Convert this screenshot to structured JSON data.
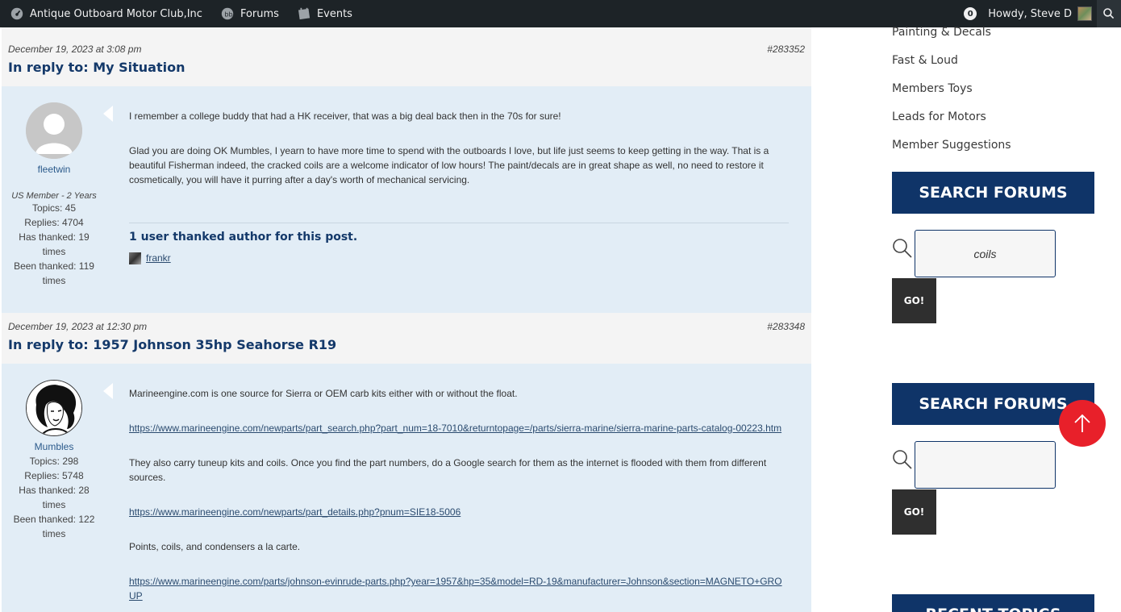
{
  "adminbar": {
    "site_name": "Antique Outboard Motor Club,Inc",
    "forums_label": "Forums",
    "events_label": "Events",
    "notification_count": "0",
    "howdy": "Howdy, Steve D"
  },
  "posts": [
    {
      "date": "December 19, 2023 at 3:08 pm",
      "id": "#283352",
      "title": "In reply to: My Situation",
      "author": {
        "name": "fleetwin",
        "role": "US Member - 2 Years",
        "topics": "Topics: 45",
        "replies": "Replies: 4704",
        "has_thanked_a": "Has thanked: 19",
        "has_thanked_b": "times",
        "been_thanked_a": "Been thanked: 119",
        "been_thanked_b": "times"
      },
      "paragraphs": [
        "I remember a college buddy that had a HK receiver, that was a big deal back then in the 70s for sure!",
        "Glad you are doing OK Mumbles, I yearn to have more time to spend with the outboards I love, but life just seems to keep getting in the way.  That is a beautiful Fisherman indeed, the cracked coils are a welcome indicator of low hours!   The paint/decals are in great shape as well, no need to restore it cosmetically, you will have it purring after a day's worth of mechanical servicing."
      ],
      "thanks_title": "1 user thanked author for this post.",
      "thanks_user": "frankr"
    },
    {
      "date": "December 19, 2023 at 12:30 pm",
      "id": "#283348",
      "title": "In reply to: 1957 Johnson 35hp Seahorse R19",
      "author": {
        "name": "Mumbles",
        "topics": "Topics: 298",
        "replies": "Replies: 5748",
        "has_thanked_a": "Has thanked: 28",
        "has_thanked_b": "times",
        "been_thanked_a": "Been thanked: 122",
        "been_thanked_b": "times"
      },
      "p1": "Marineengine.com is one source for Sierra or OEM carb kits either with or without the float.",
      "link1": "https://www.marineengine.com/newparts/part_search.php?part_num=18-7010&returntopage=/parts/sierra-marine/sierra-marine-parts-catalog-00223.htm",
      "p2": "They also carry tuneup kits and coils. Once you find the part numbers, do a Google search for them as the internet is flooded with them from different sources.",
      "link2": "https://www.marineengine.com/newparts/part_details.php?pnum=SIE18-5006",
      "p3": "Points, coils, and condensers a la carte.",
      "link3": "https://www.marineengine.com/parts/johnson-evinrude-parts.php?year=1957&hp=35&model=RD-19&manufacturer=Johnson&section=MAGNETO+GROUP"
    }
  ],
  "sidebar": {
    "categories": [
      "Painting & Decals",
      "Fast & Loud",
      "Members Toys",
      "Leads for Motors",
      "Member Suggestions"
    ],
    "search_widget_1": {
      "title": "SEARCH FORUMS",
      "value": "coils",
      "button": "GO!"
    },
    "search_widget_2": {
      "title": "SEARCH FORUMS",
      "value": "",
      "button": "GO!"
    },
    "recent_title": "RECENT TOPICS"
  },
  "colors": {
    "adminbar": "#1d2327",
    "accent": "#0f3468",
    "post_bg": "#e2edf6",
    "to_top": "#e8202a"
  }
}
